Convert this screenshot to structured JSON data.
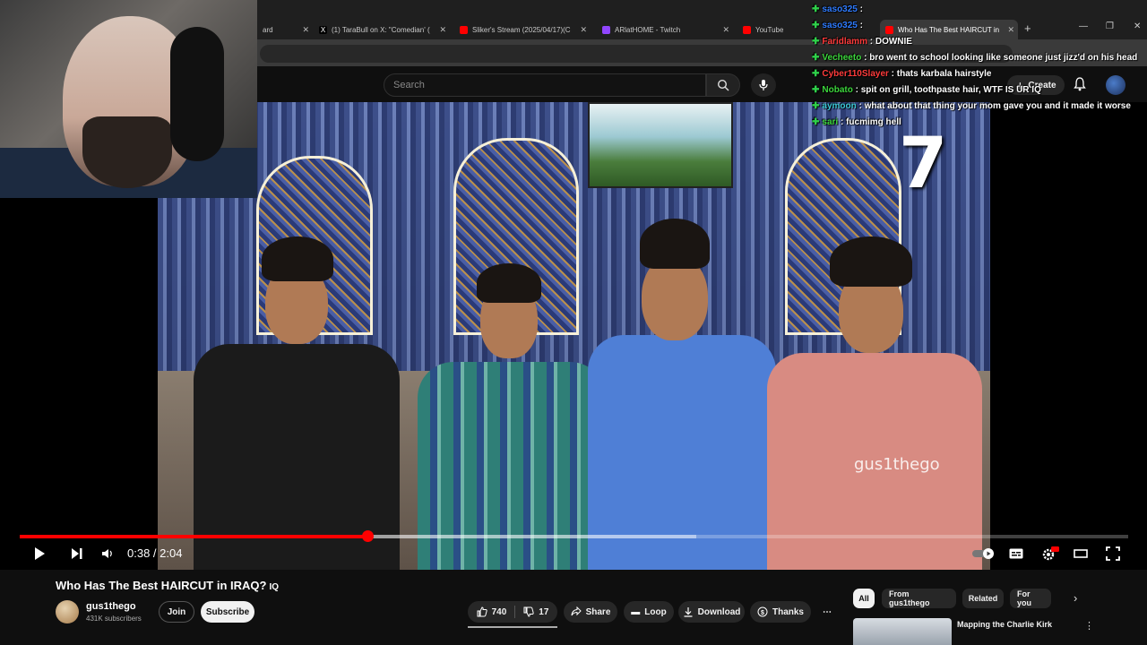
{
  "browser": {
    "tabs": [
      {
        "title": "ard",
        "fav_color": "#555555"
      },
      {
        "title": "(1) TaraBull on X: \"Comedian' (",
        "fav_color": "#000000",
        "fav_glyph": "X"
      },
      {
        "title": "Sliker's Stream (2025/04/17)(C",
        "fav_color": "#ff0000"
      },
      {
        "title": "ARlatHOME - Twitch",
        "fav_color": "#9146ff"
      },
      {
        "title": "YouTube",
        "fav_color": "#ff0000"
      },
      {
        "title": "Who Has The Best HAIRCUT in",
        "fav_color": "#ff0000"
      }
    ],
    "new_tab_glyph": "+"
  },
  "youtube_header": {
    "search_placeholder": "Search",
    "create_label": "Create"
  },
  "chat": [
    {
      "user": "saso325",
      "color": "#2e7bff",
      "message": ""
    },
    {
      "user": "saso325",
      "color": "#2e7bff",
      "message": ""
    },
    {
      "user": "Faridlamm",
      "color": "#ff3b3b",
      "message": "DOWNIE"
    },
    {
      "user": "Vecheeto",
      "color": "#3cd63c",
      "message": "bro went to school looking like someone just jizz'd on his head"
    },
    {
      "user": "Cyber110Slayer",
      "color": "#ff3b3b",
      "message": "thats karbala hairstyle"
    },
    {
      "user": "Nobato",
      "color": "#3cd63c",
      "message": "spit on grill, toothpaste hair, WTF IS UR IQ"
    },
    {
      "user": "aymoon",
      "color": "#3cc8d6",
      "message": "what about that thing your mom gave you and it made it worse"
    },
    {
      "user": "sari",
      "color": "#3cd63c",
      "message": "fucmimg hell"
    }
  ],
  "video_overlay": {
    "counter": "7",
    "watermark": "gus1thego"
  },
  "player": {
    "current_time": "0:38",
    "separator": " / ",
    "duration": "2:04",
    "progress": 0.314,
    "buffered": 0.61
  },
  "video_info": {
    "title": "Who Has The Best HAIRCUT in IRAQ?",
    "title_flag": "IQ",
    "channel_name": "gus1thego",
    "subscribers": "431K subscribers",
    "join_label": "Join",
    "subscribe_label": "Subscribe",
    "likes": "740",
    "dislikes": "17",
    "share_label": "Share",
    "loop_label": "Loop",
    "download_label": "Download",
    "thanks_label": "Thanks"
  },
  "sidebar": {
    "chips": [
      "All",
      "From gus1thego",
      "Related",
      "For you"
    ],
    "recommendation_title": "Mapping the Charlie Kirk"
  }
}
